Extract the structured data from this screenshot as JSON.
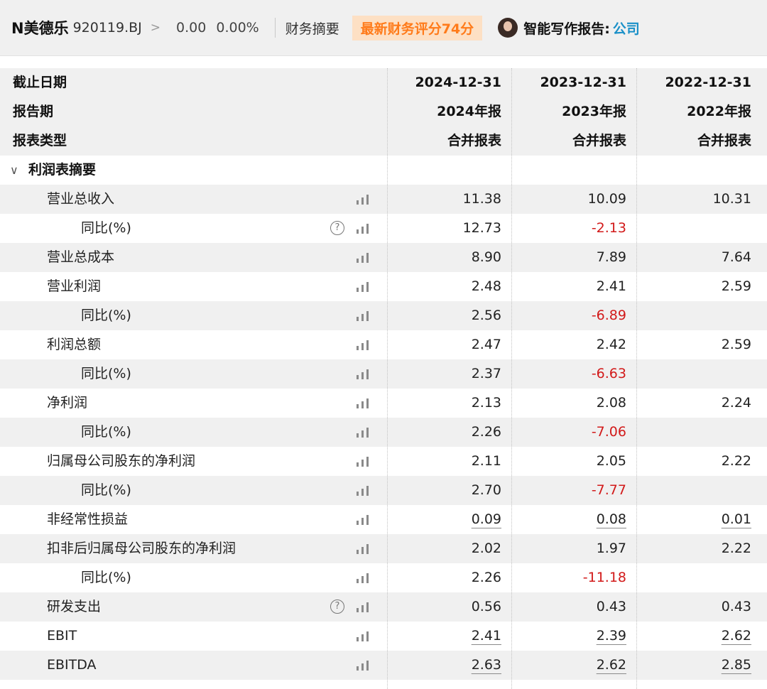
{
  "header": {
    "stock_name": "N美德乐",
    "stock_code": "920119.BJ",
    "chevron": ">",
    "price": "0.00",
    "change_pct": "0.00%",
    "tab_label": "财务摘要",
    "score_badge": "最新财务评分74分",
    "ai_label": "智能写作报告:",
    "ai_link": "公司"
  },
  "table": {
    "header_rows": [
      {
        "label": "截止日期",
        "values": [
          "2024-12-31",
          "2023-12-31",
          "2022-12-31"
        ]
      },
      {
        "label": "报告期",
        "values": [
          "2024年报",
          "2023年报",
          "2022年报"
        ]
      },
      {
        "label": "报表类型",
        "values": [
          "合并报表",
          "合并报表",
          "合并报表"
        ]
      }
    ],
    "section_title": "利润表摘要",
    "rows": [
      {
        "label": "营业总收入",
        "level": 1,
        "help": false,
        "values": [
          "11.38",
          "10.09",
          "10.31"
        ],
        "neg": [
          false,
          false,
          false
        ],
        "ul": false
      },
      {
        "label": "同比(%)",
        "level": 2,
        "help": true,
        "values": [
          "12.73",
          "-2.13",
          ""
        ],
        "neg": [
          false,
          true,
          false
        ],
        "ul": false
      },
      {
        "label": "营业总成本",
        "level": 1,
        "help": false,
        "values": [
          "8.90",
          "7.89",
          "7.64"
        ],
        "neg": [
          false,
          false,
          false
        ],
        "ul": false
      },
      {
        "label": "营业利润",
        "level": 1,
        "help": false,
        "values": [
          "2.48",
          "2.41",
          "2.59"
        ],
        "neg": [
          false,
          false,
          false
        ],
        "ul": false
      },
      {
        "label": "同比(%)",
        "level": 2,
        "help": false,
        "values": [
          "2.56",
          "-6.89",
          ""
        ],
        "neg": [
          false,
          true,
          false
        ],
        "ul": false
      },
      {
        "label": "利润总额",
        "level": 1,
        "help": false,
        "values": [
          "2.47",
          "2.42",
          "2.59"
        ],
        "neg": [
          false,
          false,
          false
        ],
        "ul": false
      },
      {
        "label": "同比(%)",
        "level": 2,
        "help": false,
        "values": [
          "2.37",
          "-6.63",
          ""
        ],
        "neg": [
          false,
          true,
          false
        ],
        "ul": false
      },
      {
        "label": "净利润",
        "level": 1,
        "help": false,
        "values": [
          "2.13",
          "2.08",
          "2.24"
        ],
        "neg": [
          false,
          false,
          false
        ],
        "ul": false
      },
      {
        "label": "同比(%)",
        "level": 2,
        "help": false,
        "values": [
          "2.26",
          "-7.06",
          ""
        ],
        "neg": [
          false,
          true,
          false
        ],
        "ul": false
      },
      {
        "label": "归属母公司股东的净利润",
        "level": 1,
        "help": false,
        "values": [
          "2.11",
          "2.05",
          "2.22"
        ],
        "neg": [
          false,
          false,
          false
        ],
        "ul": false
      },
      {
        "label": "同比(%)",
        "level": 2,
        "help": false,
        "values": [
          "2.70",
          "-7.77",
          ""
        ],
        "neg": [
          false,
          true,
          false
        ],
        "ul": false
      },
      {
        "label": "非经常性损益",
        "level": 1,
        "help": false,
        "values": [
          "0.09",
          "0.08",
          "0.01"
        ],
        "neg": [
          false,
          false,
          false
        ],
        "ul": true
      },
      {
        "label": "扣非后归属母公司股东的净利润",
        "level": 1,
        "help": false,
        "values": [
          "2.02",
          "1.97",
          "2.22"
        ],
        "neg": [
          false,
          false,
          false
        ],
        "ul": false
      },
      {
        "label": "同比(%)",
        "level": 2,
        "help": false,
        "values": [
          "2.26",
          "-11.18",
          ""
        ],
        "neg": [
          false,
          true,
          false
        ],
        "ul": false
      },
      {
        "label": "研发支出",
        "level": 1,
        "help": true,
        "values": [
          "0.56",
          "0.43",
          "0.43"
        ],
        "neg": [
          false,
          false,
          false
        ],
        "ul": false
      },
      {
        "label": "EBIT",
        "level": 1,
        "help": false,
        "values": [
          "2.41",
          "2.39",
          "2.62"
        ],
        "neg": [
          false,
          false,
          false
        ],
        "ul": true
      },
      {
        "label": "EBITDA",
        "level": 1,
        "help": false,
        "values": [
          "2.63",
          "2.62",
          "2.85"
        ],
        "neg": [
          false,
          false,
          false
        ],
        "ul": true
      }
    ]
  },
  "icons": {
    "bar": "bar-chart-icon",
    "help": "question-circle-icon",
    "help_glyph": "?",
    "collapse": "chevron-down-icon",
    "collapse_glyph": "∨"
  },
  "colors": {
    "score_bg": "#fde0c4",
    "score_text": "#ff7b1a",
    "negative": "#d21a1a",
    "link": "#1a90c8",
    "row_shade": "#f0f0f0"
  }
}
